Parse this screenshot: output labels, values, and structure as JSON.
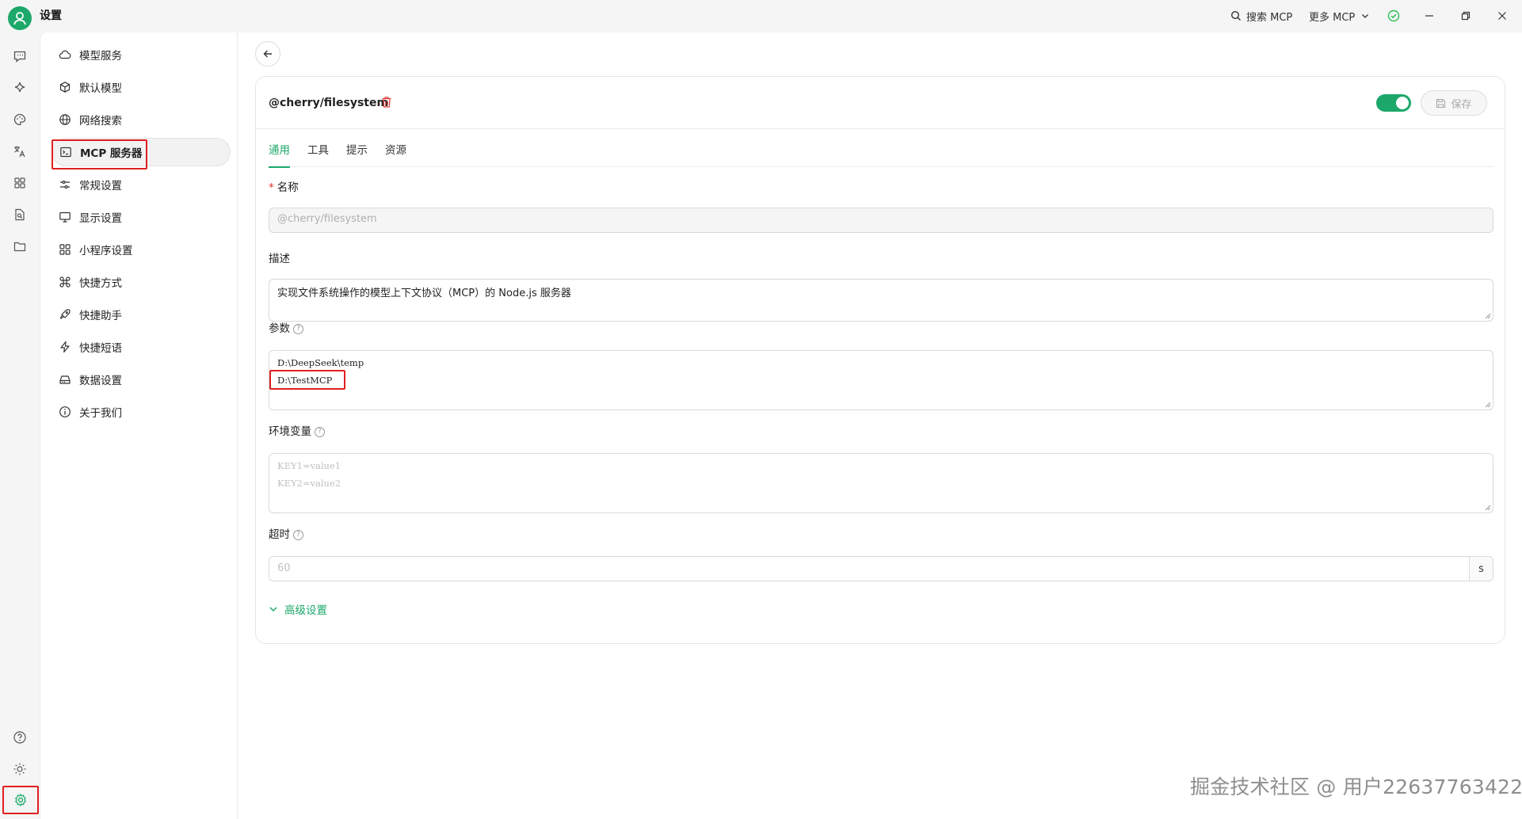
{
  "app": {
    "title": "设置"
  },
  "titlebar": {
    "search_mcp": "搜索 MCP",
    "more_mcp": "更多 MCP"
  },
  "rail": {
    "top_icons": [
      "chat-icon",
      "sparkle-icon",
      "palette-icon",
      "translate-icon",
      "apps-icon",
      "file-search-icon",
      "folder-icon"
    ],
    "bottom_icons": [
      "help-icon",
      "theme-icon",
      "settings-icon"
    ]
  },
  "nav": {
    "items": [
      {
        "label": "模型服务",
        "icon": "cloud-icon"
      },
      {
        "label": "默认模型",
        "icon": "cube-icon"
      },
      {
        "label": "网络搜索",
        "icon": "globe-icon"
      },
      {
        "label": "MCP 服务器",
        "icon": "terminal-icon",
        "active": true
      },
      {
        "label": "常规设置",
        "icon": "sliders-icon"
      },
      {
        "label": "显示设置",
        "icon": "monitor-icon"
      },
      {
        "label": "小程序设置",
        "icon": "grid-icon"
      },
      {
        "label": "快捷方式",
        "icon": "command-icon"
      },
      {
        "label": "快捷助手",
        "icon": "rocket-icon"
      },
      {
        "label": "快捷短语",
        "icon": "zap-icon"
      },
      {
        "label": "数据设置",
        "icon": "hard-drive-icon"
      },
      {
        "label": "关于我们",
        "icon": "info-icon"
      }
    ]
  },
  "server": {
    "name": "@cherry/filesystem",
    "enabled": true,
    "save_label": "保存"
  },
  "tabs": [
    "通用",
    "工具",
    "提示",
    "资源"
  ],
  "form": {
    "name_label": "名称",
    "name_value": "@cherry/filesystem",
    "desc_label": "描述",
    "desc_value": "实现文件系统操作的模型上下文协议（MCP）的 Node.js 服务器",
    "args_label": "参数",
    "args_lines": [
      "D:\\DeepSeek\\temp",
      "D:\\TestMCP"
    ],
    "env_label": "环境变量",
    "env_placeholder_lines": [
      "KEY1=value1",
      "KEY2=value2"
    ],
    "timeout_label": "超时",
    "timeout_placeholder": "60",
    "timeout_unit": "s",
    "advanced_label": "高级设置"
  },
  "watermark": "掘金技术社区 @ 用户22637763422",
  "colors": {
    "accent": "#1ca86a",
    "highlight": "#e02020"
  }
}
